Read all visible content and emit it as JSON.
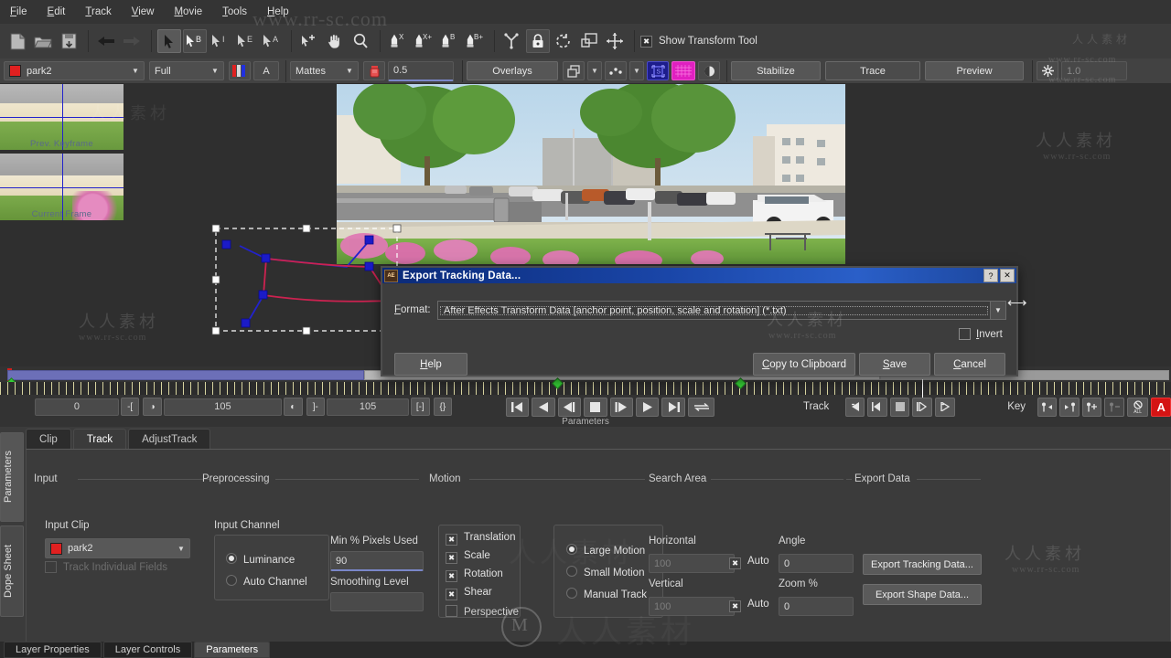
{
  "menu": {
    "items": [
      "File",
      "Edit",
      "Track",
      "View",
      "Movie",
      "Tools",
      "Help"
    ]
  },
  "toolbar": {
    "transform_tool_label": "Show Transform Tool",
    "icons": [
      "new-document-icon",
      "open-folder-icon",
      "save-icon",
      "undo-arrow-icon",
      "redo-arrow-icon",
      "select-arrow-icon",
      "select-b-icon",
      "select-i-icon",
      "select-e-icon",
      "select-a-icon",
      "add-point-icon",
      "pan-hand-icon",
      "zoom-magnifier-icon",
      "pen-x-icon",
      "pen-xplus-icon",
      "pen-b-icon",
      "pen-bplus-icon",
      "link-icon",
      "lock-icon",
      "rotate-icon",
      "duplicate-icon",
      "move-icon"
    ]
  },
  "toolbar2": {
    "layer_name": "park2",
    "quality": "Full",
    "channel_btn": "A",
    "mattes": "Mattes",
    "opacity": "0.5",
    "overlays": "Overlays",
    "stabilize": "Stabilize",
    "trace": "Trace",
    "preview": "Preview",
    "gain": "1.0",
    "icons": [
      "rgb-channels-icon",
      "alpha-icon",
      "matte-color-icon",
      "layers-icon",
      "points-icon",
      "surface-icon",
      "mesh-icon",
      "zoom-region-icon",
      "light-icon"
    ]
  },
  "viewer": {
    "thumb_prev_label": "Prev. Keyframe",
    "thumb_current_label": "Current Frame"
  },
  "timeline": {
    "in_point": "0",
    "current": "105",
    "out_point": "105",
    "track_label": "Track",
    "key_label": "Key",
    "key_all": "ALL",
    "key_a": "A",
    "panel_label": "Parameters",
    "transport_icons": [
      "go-to-start-icon",
      "play-backward-icon",
      "step-backward-icon",
      "stop-icon",
      "step-forward-icon",
      "play-forward-icon",
      "go-to-end-icon",
      "loop-icon"
    ],
    "track_icons": [
      "track-backward-all-icon",
      "track-backward-icon",
      "track-stop-icon",
      "track-forward-icon",
      "track-forward-all-icon"
    ],
    "key_icons": [
      "prev-key-icon",
      "next-key-icon",
      "add-key-icon",
      "delete-key-icon",
      "delete-all-keys-icon"
    ]
  },
  "panel": {
    "vtabs": [
      "Parameters",
      "Dope Sheet"
    ],
    "tabs": [
      {
        "label": "Clip",
        "active": false
      },
      {
        "label": "Track",
        "active": true
      },
      {
        "label": "AdjustTrack",
        "active": false
      }
    ],
    "groups": [
      "Input",
      "Preprocessing",
      "Motion",
      "Search Area",
      "Export Data"
    ],
    "input": {
      "clip_label": "Input Clip",
      "clip_value": "park2",
      "track_fields_label": "Track Individual Fields"
    },
    "preprocessing": {
      "channel_label": "Input Channel",
      "channel_options": [
        {
          "label": "Luminance",
          "selected": true
        },
        {
          "label": "Auto Channel",
          "selected": false
        }
      ],
      "min_pixels_label": "Min % Pixels Used",
      "min_pixels_value": "90",
      "smoothing_label": "Smoothing Level",
      "smoothing_value": ""
    },
    "motion": {
      "checks": [
        {
          "label": "Translation",
          "checked": true
        },
        {
          "label": "Scale",
          "checked": true
        },
        {
          "label": "Rotation",
          "checked": true
        },
        {
          "label": "Shear",
          "checked": true
        },
        {
          "label": "Perspective",
          "checked": false
        }
      ],
      "radios": [
        {
          "label": "Large Motion",
          "selected": true
        },
        {
          "label": "Small Motion",
          "selected": false
        },
        {
          "label": "Manual Track",
          "selected": false
        }
      ]
    },
    "search_area": {
      "horizontal_label": "Horizontal",
      "horizontal_value": "100",
      "horizontal_auto": "Auto",
      "vertical_label": "Vertical",
      "vertical_value": "100",
      "vertical_auto": "Auto",
      "angle_label": "Angle",
      "angle_value": "0",
      "zoom_label": "Zoom %",
      "zoom_value": "0"
    },
    "export": {
      "tracking_button": "Export Tracking Data...",
      "shape_button": "Export Shape Data..."
    },
    "bottom_tabs": [
      {
        "label": "Layer Properties",
        "active": false
      },
      {
        "label": "Layer Controls",
        "active": false
      },
      {
        "label": "Parameters",
        "active": true
      }
    ]
  },
  "dialog": {
    "title": "Export Tracking Data...",
    "help_btn": "?",
    "close_btn": "✕",
    "format_label": "Format:",
    "format_value": "After Effects Transform Data [anchor point, position, scale and rotation] (*.txt)",
    "invert_label": "Invert",
    "invert_checked": false,
    "buttons": {
      "help": "Help",
      "copy": "Copy to Clipboard",
      "save": "Save",
      "cancel": "Cancel"
    }
  },
  "watermarks": {
    "url_top": "www.rr-sc.com",
    "url": "www.rr-sc.com",
    "cn": "人人素材"
  },
  "colors": {
    "accent_blue": "#7a86c8",
    "title_blue": "#1a46a8",
    "key_red": "#d41414",
    "keyframe_green": "#34c934",
    "spline_blue": "#2222cc",
    "spline_red": "#cc2244"
  }
}
